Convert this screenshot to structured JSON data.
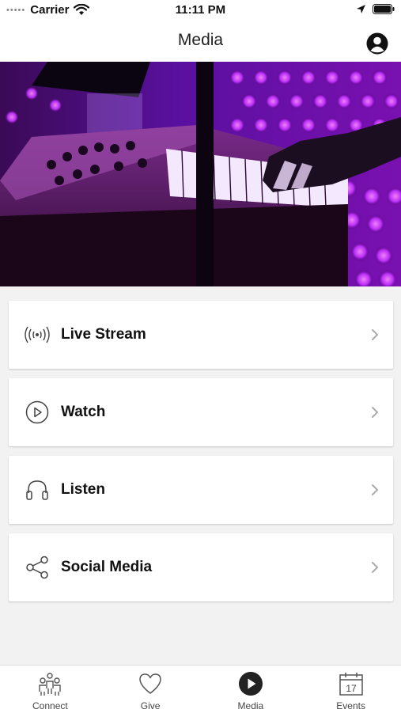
{
  "status_bar": {
    "carrier": "Carrier",
    "time": "11:11 PM"
  },
  "nav": {
    "title": "Media",
    "profile_icon": "person-circle-icon"
  },
  "menu": {
    "items": [
      {
        "label": "Live Stream",
        "icon": "broadcast-icon"
      },
      {
        "label": "Watch",
        "icon": "play-circle-icon"
      },
      {
        "label": "Listen",
        "icon": "headphones-icon"
      },
      {
        "label": "Social Media",
        "icon": "share-icon"
      }
    ]
  },
  "tabbar": {
    "items": [
      {
        "label": "Connect",
        "icon": "people-icon"
      },
      {
        "label": "Give",
        "icon": "heart-icon"
      },
      {
        "label": "Media",
        "icon": "play-circle-filled-icon",
        "active": true
      },
      {
        "label": "Events",
        "icon": "calendar-icon",
        "day": "17"
      }
    ]
  },
  "colors": {
    "accent": "#222222",
    "background": "#f2f2f2",
    "hero_purple": "#b040ff"
  }
}
